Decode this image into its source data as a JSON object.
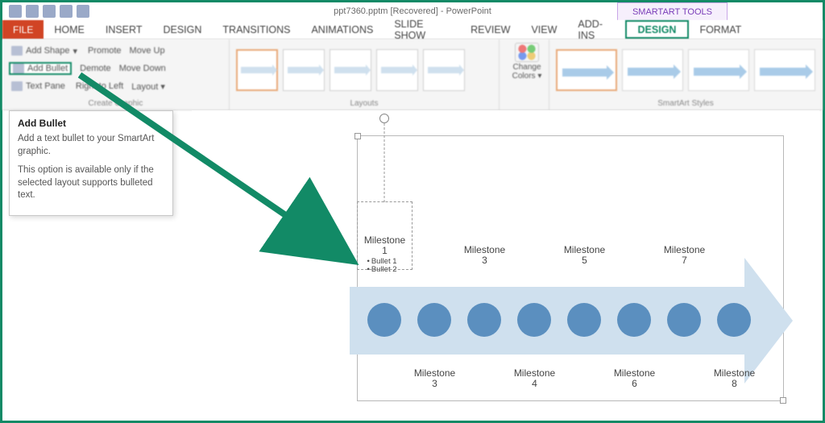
{
  "titlebar": {
    "title": "ppt7360.pptm [Recovered] - PowerPoint",
    "tool_tab": "SMARTART TOOLS"
  },
  "tabs": {
    "file": "FILE",
    "home": "HOME",
    "insert": "INSERT",
    "design_main": "DESIGN",
    "transitions": "TRANSITIONS",
    "animations": "ANIMATIONS",
    "slideshow": "SLIDE SHOW",
    "review": "REVIEW",
    "view": "VIEW",
    "addins": "ADD-INS",
    "sa_design": "DESIGN",
    "sa_format": "FORMAT"
  },
  "ribbon": {
    "create": {
      "add_shape": "Add Shape",
      "add_bullet": "Add Bullet",
      "text_pane": "Text Pane",
      "promote": "Promote",
      "demote": "Demote",
      "right_to_left": "Right to Left",
      "move_up": "Move Up",
      "move_down": "Move Down",
      "layout_btn": "Layout",
      "group_label": "Create Graphic"
    },
    "layouts": {
      "group_label": "Layouts"
    },
    "colors": {
      "label_line1": "Change",
      "label_line2": "Colors"
    },
    "styles": {
      "group_label": "SmartArt Styles"
    }
  },
  "tooltip": {
    "title": "Add Bullet",
    "body1": "Add a text bullet to your SmartArt graphic.",
    "body2": "This option is available only if the selected layout supports bulleted text."
  },
  "smartart": {
    "milestones_top": [
      {
        "label": "Milestone",
        "num": "1",
        "bullets": [
          "Bullet 1",
          "Bullet 2"
        ]
      },
      {
        "label": "Milestone",
        "num": "3"
      },
      {
        "label": "Milestone",
        "num": "5"
      },
      {
        "label": "Milestone",
        "num": "7"
      }
    ],
    "milestones_bottom": [
      {
        "label": "Milestone",
        "num": "3"
      },
      {
        "label": "Milestone",
        "num": "4"
      },
      {
        "label": "Milestone",
        "num": "6"
      },
      {
        "label": "Milestone",
        "num": "8"
      }
    ],
    "dot_count": 8
  },
  "colors": {
    "accent_green": "#128a66",
    "dot_fill": "#5b8fbf",
    "arrow_fill": "#cfe0ee"
  }
}
